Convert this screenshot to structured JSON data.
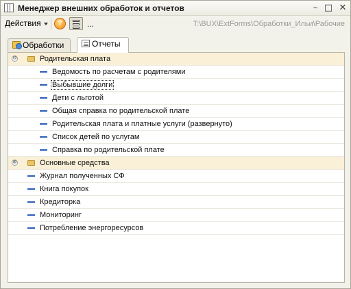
{
  "window": {
    "title": "Менеджер внешних обработок и отчетов",
    "buttons": {
      "minimize": "–",
      "maximize": "□",
      "close": "✕"
    }
  },
  "toolbar": {
    "actions_label": "Действия",
    "help_label": "?",
    "more_label": "...",
    "path": "T:\\BUX\\ExtForms\\Обработки_Ильи\\Рабочие"
  },
  "tabs": [
    {
      "label": "Обработки",
      "icon": "processing-icon",
      "active": false
    },
    {
      "label": "Отчеты",
      "icon": "report-icon",
      "active": true
    }
  ],
  "tree": {
    "groups": [
      {
        "label": "Родительская плата",
        "expander": "⊖",
        "expanded": true,
        "items": [
          "Ведомость по расчетам с родителями",
          "Выбывшие долги",
          "Дети с льготой",
          "Общая справка по родительской плате",
          "Родительская плата и платные услуги (развернуто)",
          "Список детей по услугам",
          "Справка по родительской плате"
        ],
        "selected_index": 1
      },
      {
        "label": "Основные средства",
        "expander": "⊕",
        "expanded": false,
        "items": []
      }
    ],
    "root_items": [
      "Журнал полученных СФ",
      "Книга покупок",
      "Кредиторка",
      "Мониторинг",
      "Потребление энергоресурсов"
    ]
  },
  "colors": {
    "group_row": "#faf0d8",
    "item_dash": "#2a5db8",
    "window_bg": "#f3f2ea"
  }
}
